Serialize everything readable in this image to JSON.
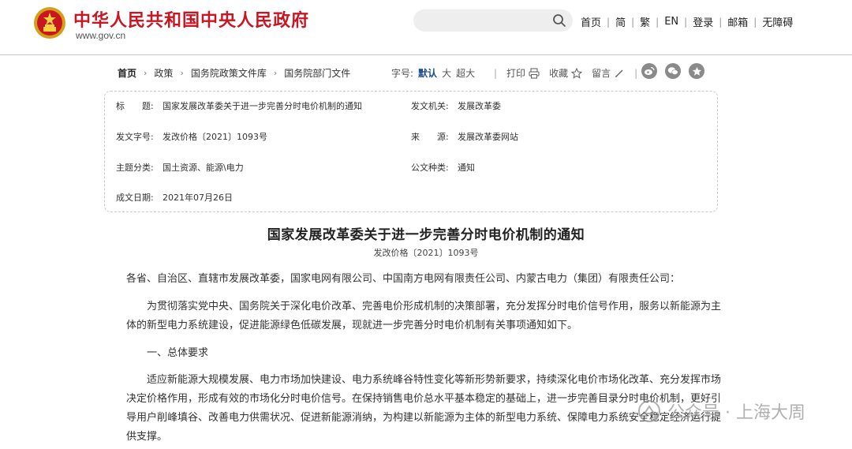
{
  "header": {
    "site_title": "中华人民共和国中央人民政府",
    "site_url": "www.gov.cn",
    "nav": [
      "首页",
      "简",
      "繁",
      "EN",
      "登录",
      "邮箱",
      "无障碍"
    ]
  },
  "toolbar": {
    "crumbs": [
      "首页",
      "政策",
      "国务院政策文件库",
      "国务院部门文件"
    ],
    "font_label": "字号:",
    "font_default": "默认",
    "font_large": "大",
    "font_xlarge": "超大",
    "print": "打印",
    "favorite": "收藏",
    "comment": "留言"
  },
  "info": {
    "title_label": "标　　题:",
    "title_value": "国家发展改革委关于进一步完善分时电价机制的通知",
    "issuer_label": "发文机关:",
    "issuer_value": "发展改革委",
    "docno_label": "发文字号:",
    "docno_value": "发改价格〔2021〕1093号",
    "source_label": "来　　源:",
    "source_value": "发展改革委网站",
    "topic_label": "主题分类:",
    "topic_value": "国土资源、能源\\电力",
    "type_label": "公文种类:",
    "type_value": "通知",
    "date_label": "成文日期:",
    "date_value": "2021年07月26日"
  },
  "article": {
    "title": "国家发展改革委关于进一步完善分时电价机制的通知",
    "doc_number": "发改价格〔2021〕1093号",
    "p1": "各省、自治区、直辖市发展改革委，国家电网有限公司、中国南方电网有限责任公司、内蒙古电力（集团）有限责任公司：",
    "p2": "为贯彻落实党中央、国务院关于深化电价改革、完善电价形成机制的决策部署，充分发挥分时电价信号作用，服务以新能源为主体的新型电力系统建设，促进能源绿色低碳发展，现就进一步完善分时电价机制有关事项通知如下。",
    "p3": "一、总体要求",
    "p4": "适应新能源大规模发展、电力市场加快建设、电力系统峰谷特性变化等新形势新要求，持续深化电价市场化改革、充分发挥市场决定价格作用，形成有效的市场化分时电价信号。在保持销售电价总水平基本稳定的基础上，进一步完善目录分时电价机制，更好引导用户削峰填谷、改善电力供需状况、促进新能源消纳，为构建以新能源为主体的新型电力系统、保障电力系统安全稳定经济运行提供支撑。"
  },
  "watermark": {
    "text": "公众号 · 上海大周"
  },
  "colors": {
    "brand_red": "#c81623",
    "link_blue": "#1a4e8a"
  }
}
